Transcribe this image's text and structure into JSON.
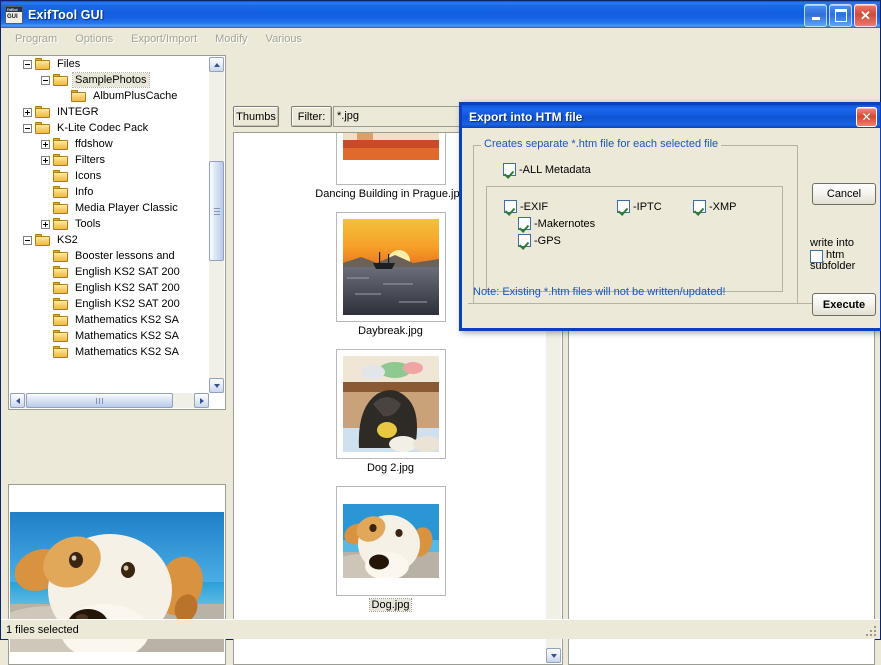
{
  "window": {
    "title": "ExifTool GUI",
    "icon": "exiftool-app-icon",
    "buttons": {
      "minimize": "–",
      "maximize": "□",
      "close": "✕"
    }
  },
  "menu": {
    "items": [
      {
        "label": "Program"
      },
      {
        "label": "Options"
      },
      {
        "label": "Export/Import"
      },
      {
        "label": "Modify"
      },
      {
        "label": "Various"
      }
    ]
  },
  "toolbar": {
    "thumbs_label": "Thumbs",
    "filter_label": "Filter:",
    "filter_value": "*.jpg"
  },
  "tree": {
    "items": [
      {
        "label": "Files",
        "indent": 1,
        "node": "minus",
        "selected": false
      },
      {
        "label": "SamplePhotos",
        "indent": 2,
        "node": "minus",
        "selected": true
      },
      {
        "label": "AlbumPlusCache",
        "indent": 3,
        "node": "none",
        "selected": false
      },
      {
        "label": "INTEGR",
        "indent": 1,
        "node": "plus",
        "selected": false
      },
      {
        "label": "K-Lite Codec Pack",
        "indent": 1,
        "node": "minus",
        "selected": false
      },
      {
        "label": "ffdshow",
        "indent": 2,
        "node": "plus",
        "selected": false
      },
      {
        "label": "Filters",
        "indent": 2,
        "node": "plus",
        "selected": false
      },
      {
        "label": "Icons",
        "indent": 2,
        "node": "none",
        "selected": false
      },
      {
        "label": "Info",
        "indent": 2,
        "node": "none",
        "selected": false
      },
      {
        "label": "Media Player Classic",
        "indent": 2,
        "node": "none",
        "selected": false
      },
      {
        "label": "Tools",
        "indent": 2,
        "node": "plus",
        "selected": false
      },
      {
        "label": "KS2",
        "indent": 1,
        "node": "minus",
        "selected": false
      },
      {
        "label": "Booster lessons and",
        "indent": 2,
        "node": "none",
        "selected": false
      },
      {
        "label": "English KS2 SAT 200",
        "indent": 2,
        "node": "none",
        "selected": false
      },
      {
        "label": "English KS2 SAT 200",
        "indent": 2,
        "node": "none",
        "selected": false
      },
      {
        "label": "English KS2 SAT 200",
        "indent": 2,
        "node": "none",
        "selected": false
      },
      {
        "label": "Mathematics KS2 SA",
        "indent": 2,
        "node": "none",
        "selected": false
      },
      {
        "label": "Mathematics KS2 SA",
        "indent": 2,
        "node": "none",
        "selected": false
      },
      {
        "label": "Mathematics KS2 SA",
        "indent": 2,
        "node": "none",
        "selected": false
      }
    ]
  },
  "thumbnails": {
    "items": [
      {
        "caption": "Dancing Building in Prague.jpg",
        "selected": false,
        "image": "prague-building-thumb"
      },
      {
        "caption": "Daybreak.jpg",
        "selected": false,
        "image": "daybreak-sunset-thumb"
      },
      {
        "caption": "Dog 2.jpg",
        "selected": false,
        "image": "dog2-thumb"
      },
      {
        "caption": "Dog.jpg",
        "selected": true,
        "image": "dog-thumb"
      }
    ]
  },
  "preview": {
    "image": "dog-preview"
  },
  "dialog": {
    "title": "Export into HTM file",
    "close_label": "✕",
    "groupbox_label": "Creates separate *.htm file for each selected file",
    "all_metadata": {
      "label": "-ALL Metadata",
      "checked": true
    },
    "options": [
      {
        "label": "-EXIF",
        "checked": true
      },
      {
        "label": "-IPTC",
        "checked": true
      },
      {
        "label": "-XMP",
        "checked": true
      },
      {
        "label": "-Makernotes",
        "checked": true
      },
      {
        "label": "-GPS",
        "checked": true
      }
    ],
    "cancel_label": "Cancel",
    "execute_label": "Execute",
    "subfolder": {
      "label_line1": "write into",
      "label_line2": "htm",
      "label_line3": "subfolder",
      "checked": false
    },
    "note": "Note: Existing *.htm files will not be written/updated!"
  },
  "status": {
    "text": "1 files selected"
  },
  "colors": {
    "titlebar_blue": "#1360e0",
    "dialog_blue": "#0f54d4",
    "dialog_border": "#0a3fbf",
    "face": "#ece9d8",
    "group_label_blue": "#1754c4",
    "check_green": "#2f7a2f",
    "disabled_menu": "#a5a397"
  }
}
